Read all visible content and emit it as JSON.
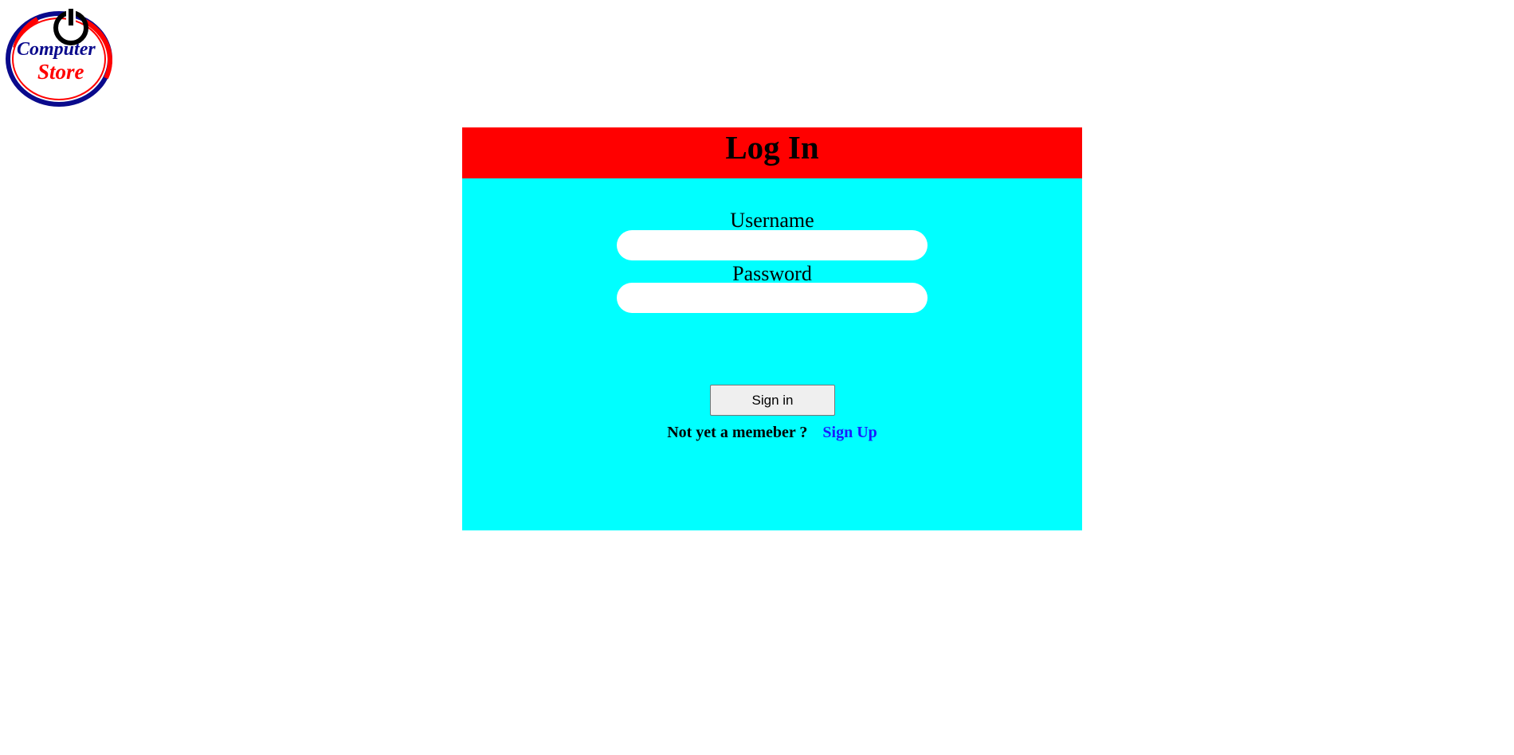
{
  "logo": {
    "line1": "Computer",
    "line2": "Store",
    "icon": "power-icon",
    "colors": {
      "red": "#ff0000",
      "blue": "#0a0a8c",
      "black": "#000000"
    }
  },
  "login": {
    "title": "Log In",
    "username_label": "Username",
    "username_value": "",
    "password_label": "Password",
    "password_value": "",
    "submit_label": "Sign in",
    "signup_prompt": "Not yet a memeber ?",
    "signup_link": "Sign Up"
  },
  "colors": {
    "header_bg": "#ff0000",
    "panel_bg": "#00ffff",
    "link": "#1a1aff"
  }
}
